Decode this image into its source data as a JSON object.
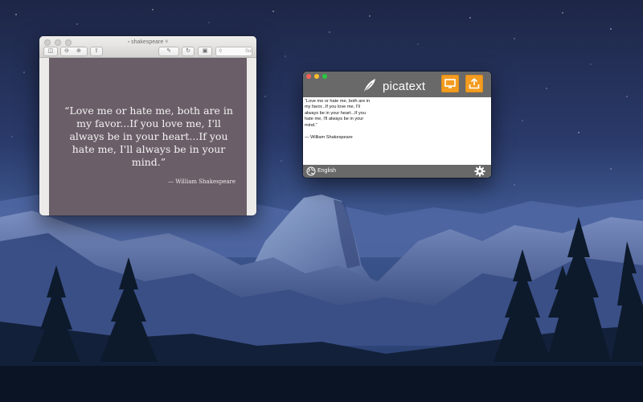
{
  "preview_window": {
    "title": "shakespeare",
    "search_placeholder": "Suchen",
    "document": {
      "quote_lines": [
        "“Love me or hate me, both are in",
        "my favor...If you love me, I'll",
        "always be in your heart...If you",
        "hate me, I'll always be in your",
        "mind.”"
      ],
      "attribution": "— William Shakespeare"
    },
    "colors": {
      "document_background": "#6a5f68"
    }
  },
  "picatext_window": {
    "app_name": "picatext",
    "buttons": {
      "display_icon": "monitor-icon",
      "export_icon": "share-upload-icon"
    },
    "text_lines": [
      "“Love me or hate me, both are in",
      "my favor...If you love me, I'll",
      "always be in your heart...If you",
      "hate me, I'll always be in your",
      "mind.”"
    ],
    "signature": "— William Shakespeare",
    "language": "English",
    "colors": {
      "accent": "#f39c1f",
      "chrome": "#696969",
      "traffic_close": "#ff5f56",
      "traffic_minimize": "#ffbd2e",
      "traffic_zoom": "#27c93f"
    }
  }
}
